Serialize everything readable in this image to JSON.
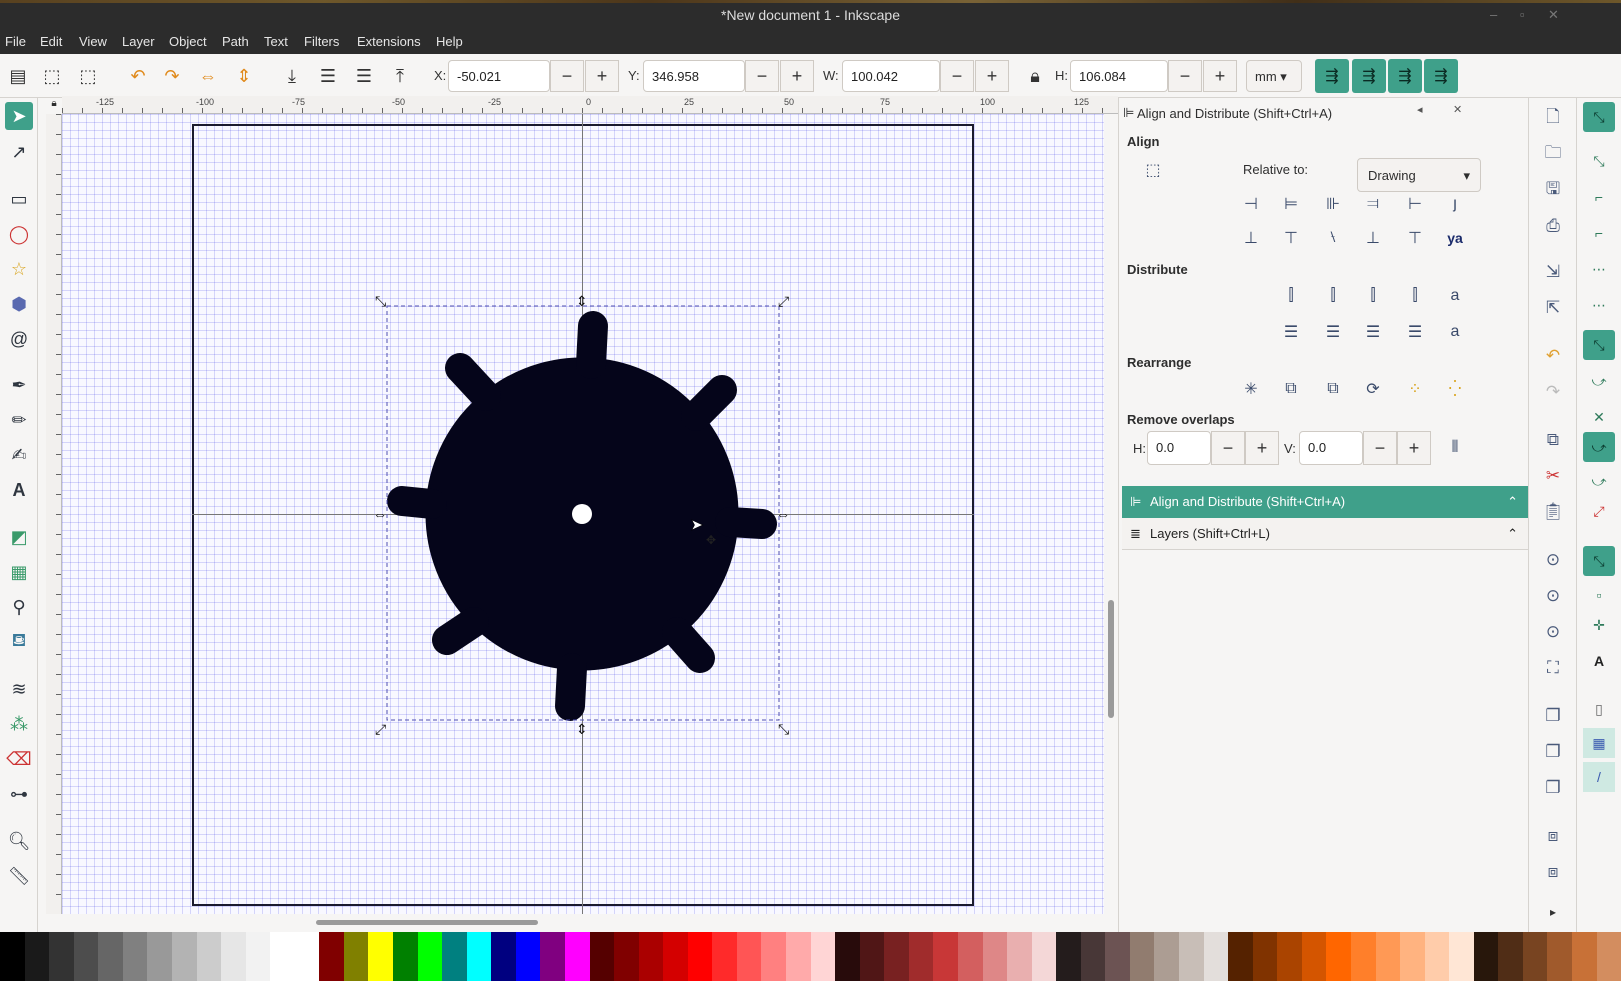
{
  "window": {
    "title": "*New document 1 - Inkscape",
    "min": "–",
    "max": "▫",
    "close": "✕"
  },
  "menu": [
    "File",
    "Edit",
    "View",
    "Layer",
    "Object",
    "Path",
    "Text",
    "Filters",
    "Extensions",
    "Help"
  ],
  "toolctrl": {
    "x_label": "X:",
    "x_value": "-50.021",
    "y_label": "Y:",
    "y_value": "346.958",
    "w_label": "W:",
    "w_value": "100.042",
    "h_label": "H:",
    "h_value": "106.084",
    "unit": "mm",
    "minus": "−",
    "plus": "+"
  },
  "ruler": {
    "h_labels": [
      "-125",
      "-100",
      "-75",
      "-50",
      "-25",
      "0",
      "25",
      "50",
      "75",
      "100",
      "125"
    ]
  },
  "dock": {
    "title": "Align and Distribute (Shift+Ctrl+A)",
    "align_heading": "Align",
    "relative_label": "Relative to:",
    "relative_value": "Drawing",
    "distribute_heading": "Distribute",
    "rearrange_heading": "Rearrange",
    "overlaps_heading": "Remove overlaps",
    "h_label": "H:",
    "h_value": "0.0",
    "v_label": "V:",
    "v_value": "0.0",
    "tab_active": "Align and Distribute (Shift+Ctrl+A)",
    "tab_layers": "Layers (Shift+Ctrl+L)"
  },
  "colors": {
    "accent": "#3fa08a",
    "shape": "#05051a"
  },
  "palette": [
    "#000000",
    "#1a1a1a",
    "#333333",
    "#4d4d4d",
    "#666666",
    "#808080",
    "#999999",
    "#b3b3b3",
    "#cccccc",
    "#e6e6e6",
    "#f2f2f2",
    "#ffffff",
    "#ffffff",
    "#800000",
    "#808000",
    "#ffff00",
    "#008000",
    "#00ff00",
    "#008080",
    "#00ffff",
    "#000080",
    "#0000ff",
    "#800080",
    "#ff00ff",
    "#550000",
    "#800000",
    "#aa0000",
    "#d40000",
    "#ff0000",
    "#ff2a2a",
    "#ff5555",
    "#ff8080",
    "#ffaaaa",
    "#ffd5d5",
    "#280b0b",
    "#501616",
    "#782121",
    "#a02c2c",
    "#c83737",
    "#d35f5f",
    "#de8787",
    "#e9afaf",
    "#f4d7d7",
    "#241c1c",
    "#483737",
    "#6c5353",
    "#917c6f",
    "#ac9d93",
    "#c8beb7",
    "#e3dedb",
    "#552200",
    "#803300",
    "#aa4400",
    "#d45500",
    "#ff6600",
    "#ff7f2a",
    "#ff9955",
    "#ffb380",
    "#ffccaa",
    "#ffe6d5",
    "#28170b",
    "#502d16",
    "#784421",
    "#a05a2c",
    "#c87137",
    "#d38d5f"
  ]
}
